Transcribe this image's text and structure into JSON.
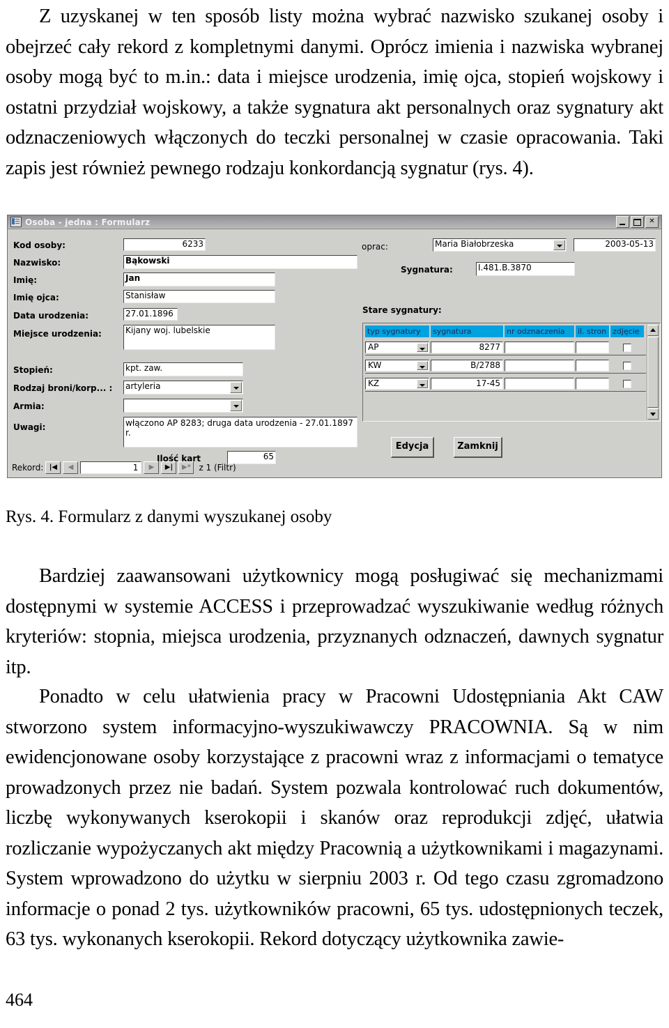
{
  "document": {
    "page_number": "464",
    "paragraph_top": "Z uzyskanej w ten sposób listy można wybrać nazwisko szukanej osoby i obejrzeć cały rekord z kompletnymi danymi. Oprócz imienia i nazwiska wybranej osoby mogą być to m.in.: data i miejsce urodzenia, imię ojca, stopień wojskowy i ostatni przydział wojskowy, a także sygnatura akt personalnych oraz sygnatury akt odznaczeniowych włączonych do teczki personalnej w czasie opracowania. Taki zapis jest również pewnego rodzaju konkordancją sygnatur (rys. 4).",
    "figure_caption": "Rys. 4. Formularz z danymi wyszukanej osoby",
    "paragraph_mid": "Bardziej zaawansowani użytkownicy mogą posługiwać się mechanizmami dostępnymi w systemie ACCESS i przeprowadzać wyszukiwanie według różnych kryteriów: stopnia, miejsca urodzenia, przyznanych odznaczeń, dawnych sygnatur itp.",
    "paragraph_bottom": "Ponadto w celu ułatwienia pracy w Pracowni Udostępniania Akt CAW stworzono system informacyjno-wyszukiwawczy PRACOWNIA. Są w nim ewidencjonowane osoby korzystające z pracowni wraz z informacjami o tematyce prowadzonych przez nie badań. System pozwala kontrolować ruch dokumentów, liczbę wykonywanych kserokopii i skanów oraz reprodukcji zdjęć, ułatwia rozliczanie wypożyczanych akt między Pracownią a użytkownikami i magazynami. System wprowadzono do użytku w sierpniu 2003 r. Od tego czasu zgromadzono informacje o ponad 2 tys. użytkowników pracowni, 65 tys. udostępnionych teczek, 63 tys. wykonanych kserokopii. Rekord dotyczący użytkownika zawie-"
  },
  "access_form": {
    "titlebar": {
      "title": "Osoba - jedna : Formularz",
      "icon": "form-window-icon",
      "minimize_label": "_",
      "maximize_label": "□",
      "close_label": "✕"
    },
    "colors": {
      "window_face": "#cfcfcb",
      "header_blue": "#00a2e0",
      "titlebar_gradient_start": "#8d8d93",
      "titlebar_gradient_end": "#babab8",
      "field_background": "#ffffff"
    },
    "left_fields": [
      {
        "label": "Kod osoby:",
        "value": "6233"
      },
      {
        "label": "Nazwisko:",
        "value": "Bąkowski"
      },
      {
        "label": "Imię:",
        "value": "Jan"
      },
      {
        "label": "Imię ojca:",
        "value": "Stanisław"
      },
      {
        "label": "Data urodzenia:",
        "value": "27.01.1896"
      },
      {
        "label": "Miejsce urodzenia:",
        "value": "Kijany woj. lubelskie"
      },
      {
        "label": "Stopień:",
        "value": "kpt. zaw."
      },
      {
        "label": "Rodzaj broni/korp... :",
        "value": "artyleria"
      },
      {
        "label": "Armia:",
        "value": ""
      },
      {
        "label": "Uwagi:",
        "value": "włączono AP 8283; druga data urodzenia - 27.01.1897 r."
      }
    ],
    "cards_count": {
      "label": "Ilość kart",
      "value": "65"
    },
    "right_header": {
      "oprac_label": "oprac:",
      "oprac_value": "Maria Białobrzeska",
      "date_value": "2003-05-13",
      "sygnatura_label": "Sygnatura:",
      "sygnatura_value": "I.481.B.3870",
      "old_signatures_label": "Stare sygnatury:"
    },
    "subform": {
      "columns": [
        "typ sygnatury",
        "sygnatura",
        "nr odznaczenia",
        "il. stron",
        "zdjęcie"
      ],
      "rows": [
        {
          "typ": "AP",
          "sygnatura": "8277",
          "nr_odznaczenia": "",
          "il_stron": "",
          "zdjecie": false
        },
        {
          "typ": "KW",
          "sygnatura": "B/2788",
          "nr_odznaczenia": "",
          "il_stron": "",
          "zdjecie": false
        },
        {
          "typ": "KZ",
          "sygnatura": "17-45",
          "nr_odznaczenia": "",
          "il_stron": "",
          "zdjecie": false
        }
      ]
    },
    "buttons": {
      "edit": "Edycja",
      "close": "Zamknij"
    },
    "record_navigator": {
      "label": "Rekord:",
      "first": "|◀",
      "previous": "◀",
      "current": "1",
      "next": "▶",
      "last": "▶|",
      "new": "▶*",
      "of_text": "z  1 (Filtr)"
    }
  }
}
